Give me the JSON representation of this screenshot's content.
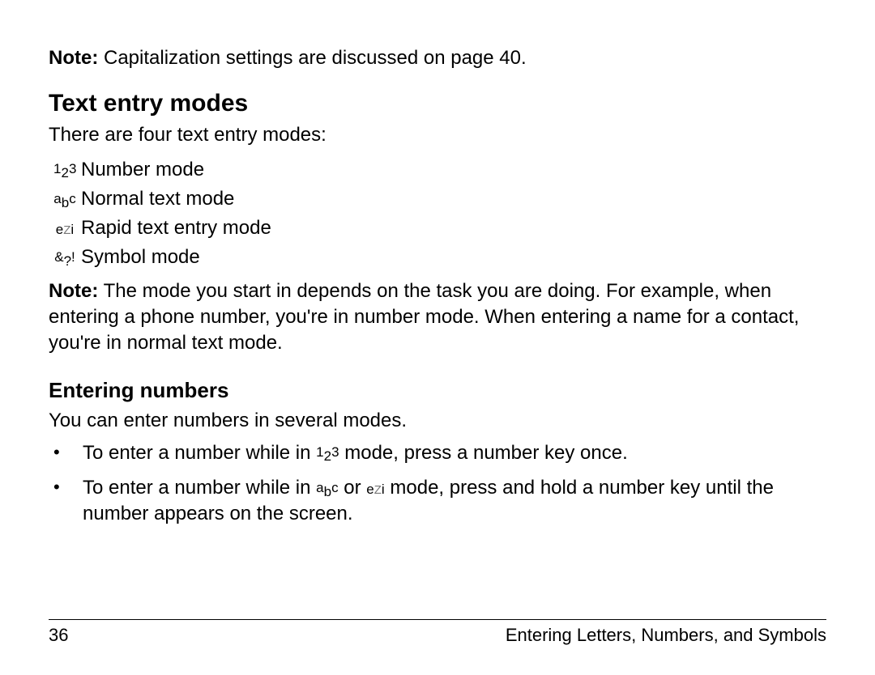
{
  "topNote": {
    "label": "Note:",
    "text": "Capitalization settings are discussed on page 40."
  },
  "heading1": "Text entry modes",
  "intro": "There are four text entry modes:",
  "modes": [
    {
      "icon": "123-icon",
      "label": "Number mode"
    },
    {
      "icon": "abc-icon",
      "label": "Normal text mode"
    },
    {
      "icon": "ezi-icon",
      "label": "Rapid text entry mode"
    },
    {
      "icon": "sym-icon",
      "label": "Symbol mode"
    }
  ],
  "note2": {
    "label": "Note:",
    "text": "The mode you start in depends on the task you are doing. For example, when entering a phone number, you're in number mode. When entering a name for a contact, you're in normal text mode."
  },
  "heading2": "Entering numbers",
  "body2": "You can enter numbers in several modes.",
  "bullets": {
    "b1_a": "To enter a number while in ",
    "b1_b": " mode, press a number key once.",
    "b2_a": "To enter a number while in ",
    "b2_b": " or ",
    "b2_c": " mode, press and hold a number key until the number appears on the screen."
  },
  "footer": {
    "page": "36",
    "section": "Entering Letters, Numbers, and Symbols"
  }
}
